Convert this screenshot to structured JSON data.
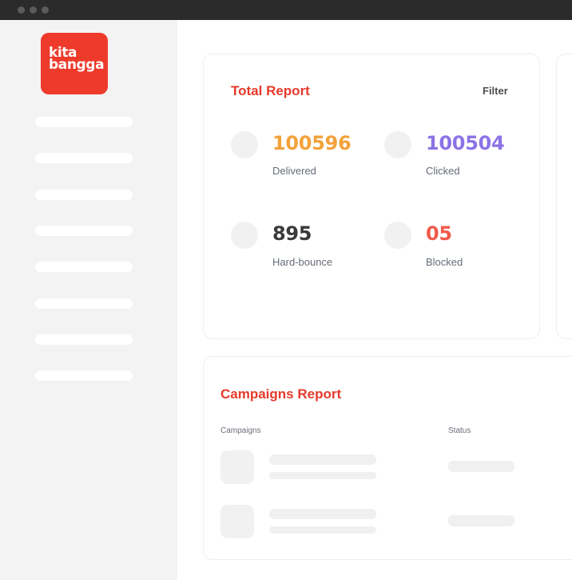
{
  "app": {
    "logo_line1": "kita",
    "logo_line2": "bangga",
    "brand_color": "#ee3a2a"
  },
  "sidebar": {
    "nav_placeholder_count_visible": 8
  },
  "total_report": {
    "title": "Total Report",
    "filter_label": "Filter",
    "stats": [
      {
        "value": "100596",
        "label": "Delivered",
        "color": "#f3a23a"
      },
      {
        "value": "100504",
        "label": "Clicked",
        "color": "#8b73e6"
      },
      {
        "value": "895",
        "label": "Hard-bounce",
        "color": "#3a3a3a"
      },
      {
        "value": "05",
        "label": "Blocked",
        "color": "#f15a4a"
      }
    ]
  },
  "campaigns_report": {
    "title": "Campaigns Report",
    "columns": [
      "Campaigns",
      "Status"
    ]
  }
}
